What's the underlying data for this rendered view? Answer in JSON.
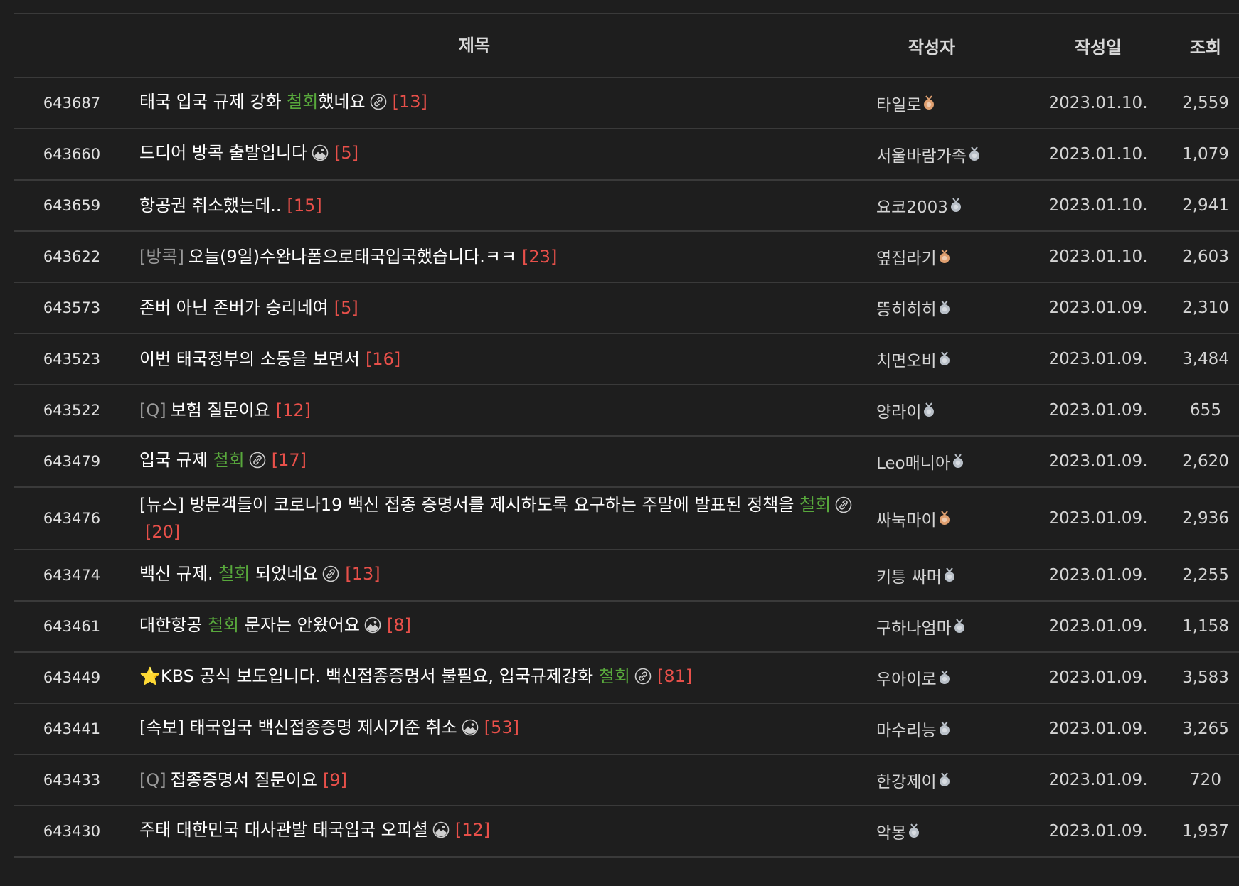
{
  "header": {
    "title": "제목",
    "author": "작성자",
    "date": "작성일",
    "views": "조회"
  },
  "colors": {
    "background": "#1e1e1e",
    "divider": "#3a3a3a",
    "highlight_green": "#58a83c",
    "comment_red": "#e8504a",
    "prefix_gray": "#9a9a9a",
    "badge_silver": "#b9c0c8",
    "badge_bronze": "#e0a070"
  },
  "posts": [
    {
      "num": "643687",
      "prefix": "",
      "t1": "태국 입국 규제 강화 ",
      "hl": "철회",
      "t2": "했네요",
      "icon": "link-icon",
      "comments": "[13]",
      "author": "타일로",
      "badge": "bronze",
      "date": "2023.01.10.",
      "views": "2,559"
    },
    {
      "num": "643660",
      "prefix": "",
      "t1": "드디어 방콕 출발입니다",
      "hl": "",
      "t2": "",
      "icon": "image-icon",
      "comments": "[5]",
      "author": "서울바람가족",
      "badge": "silver",
      "date": "2023.01.10.",
      "views": "1,079"
    },
    {
      "num": "643659",
      "prefix": "",
      "t1": "항공권 취소했는데..",
      "hl": "",
      "t2": "",
      "icon": "",
      "comments": "[15]",
      "author": "요코2003",
      "badge": "silver",
      "date": "2023.01.10.",
      "views": "2,941"
    },
    {
      "num": "643622",
      "prefix": "[방콕]",
      "t1": "오늘(9일)수완나폼으로태국입국했습니다.ㅋㅋ",
      "hl": "",
      "t2": "",
      "icon": "",
      "comments": "[23]",
      "author": "옆집라기",
      "badge": "bronze",
      "date": "2023.01.10.",
      "views": "2,603"
    },
    {
      "num": "643573",
      "prefix": "",
      "t1": "존버 아닌 존버가 승리네여",
      "hl": "",
      "t2": "",
      "icon": "",
      "comments": "[5]",
      "author": "뜽히히히",
      "badge": "silver",
      "date": "2023.01.09.",
      "views": "2,310"
    },
    {
      "num": "643523",
      "prefix": "",
      "t1": "이번 태국정부의 소동을 보면서",
      "hl": "",
      "t2": "",
      "icon": "",
      "comments": "[16]",
      "author": "치면오비",
      "badge": "silver",
      "date": "2023.01.09.",
      "views": "3,484"
    },
    {
      "num": "643522",
      "prefix": "[Q]",
      "t1": "보험 질문이요",
      "hl": "",
      "t2": "",
      "icon": "",
      "comments": "[12]",
      "author": "양라이",
      "badge": "silver",
      "date": "2023.01.09.",
      "views": "655"
    },
    {
      "num": "643479",
      "prefix": "",
      "t1": "입국 규제 ",
      "hl": "철회",
      "t2": "",
      "icon": "link-icon",
      "comments": "[17]",
      "author": "Leo매니아",
      "badge": "silver",
      "date": "2023.01.09.",
      "views": "2,620"
    },
    {
      "num": "643476",
      "prefix": "",
      "t1": "[뉴스] 방문객들이 코로나19 백신 접종 증명서를 제시하도록 요구하는 주말에 발표된 정책을 ",
      "hl": "철회",
      "t2": "",
      "icon": "link-icon",
      "comments": "[20]",
      "author": "싸눅마이",
      "badge": "bronze",
      "date": "2023.01.09.",
      "views": "2,936",
      "tall": true
    },
    {
      "num": "643474",
      "prefix": "",
      "t1": "백신 규제. ",
      "hl": "철회",
      "t2": " 되었네요",
      "icon": "link-icon",
      "comments": "[13]",
      "author": "키틍 싸머",
      "badge": "silver",
      "date": "2023.01.09.",
      "views": "2,255"
    },
    {
      "num": "643461",
      "prefix": "",
      "t1": "대한항공 ",
      "hl": "철회",
      "t2": " 문자는 안왔어요",
      "icon": "image-icon",
      "comments": "[8]",
      "author": "구하나엄마",
      "badge": "silver",
      "date": "2023.01.09.",
      "views": "1,158"
    },
    {
      "num": "643449",
      "prefix": "",
      "t1": "⭐KBS 공식 보도입니다. 백신접종증명서 불필요, 입국규제강화 ",
      "hl": "철회",
      "t2": "",
      "icon": "link-icon",
      "comments": "[81]",
      "author": "우아이로",
      "badge": "silver",
      "date": "2023.01.09.",
      "views": "3,583"
    },
    {
      "num": "643441",
      "prefix": "",
      "t1": "[속보] 태국입국 백신접종증명 제시기준 취소",
      "hl": "",
      "t2": "",
      "icon": "image-icon",
      "comments": "[53]",
      "author": "마수리능",
      "badge": "silver",
      "date": "2023.01.09.",
      "views": "3,265"
    },
    {
      "num": "643433",
      "prefix": "[Q]",
      "t1": "접종증명서 질문이요",
      "hl": "",
      "t2": "",
      "icon": "",
      "comments": "[9]",
      "author": "한강제이",
      "badge": "silver",
      "date": "2023.01.09.",
      "views": "720"
    },
    {
      "num": "643430",
      "prefix": "",
      "t1": "주태 대한민국 대사관발 태국입국 오피셜",
      "hl": "",
      "t2": "",
      "icon": "image-icon",
      "comments": "[12]",
      "author": "악몽",
      "badge": "silver",
      "date": "2023.01.09.",
      "views": "1,937"
    }
  ]
}
